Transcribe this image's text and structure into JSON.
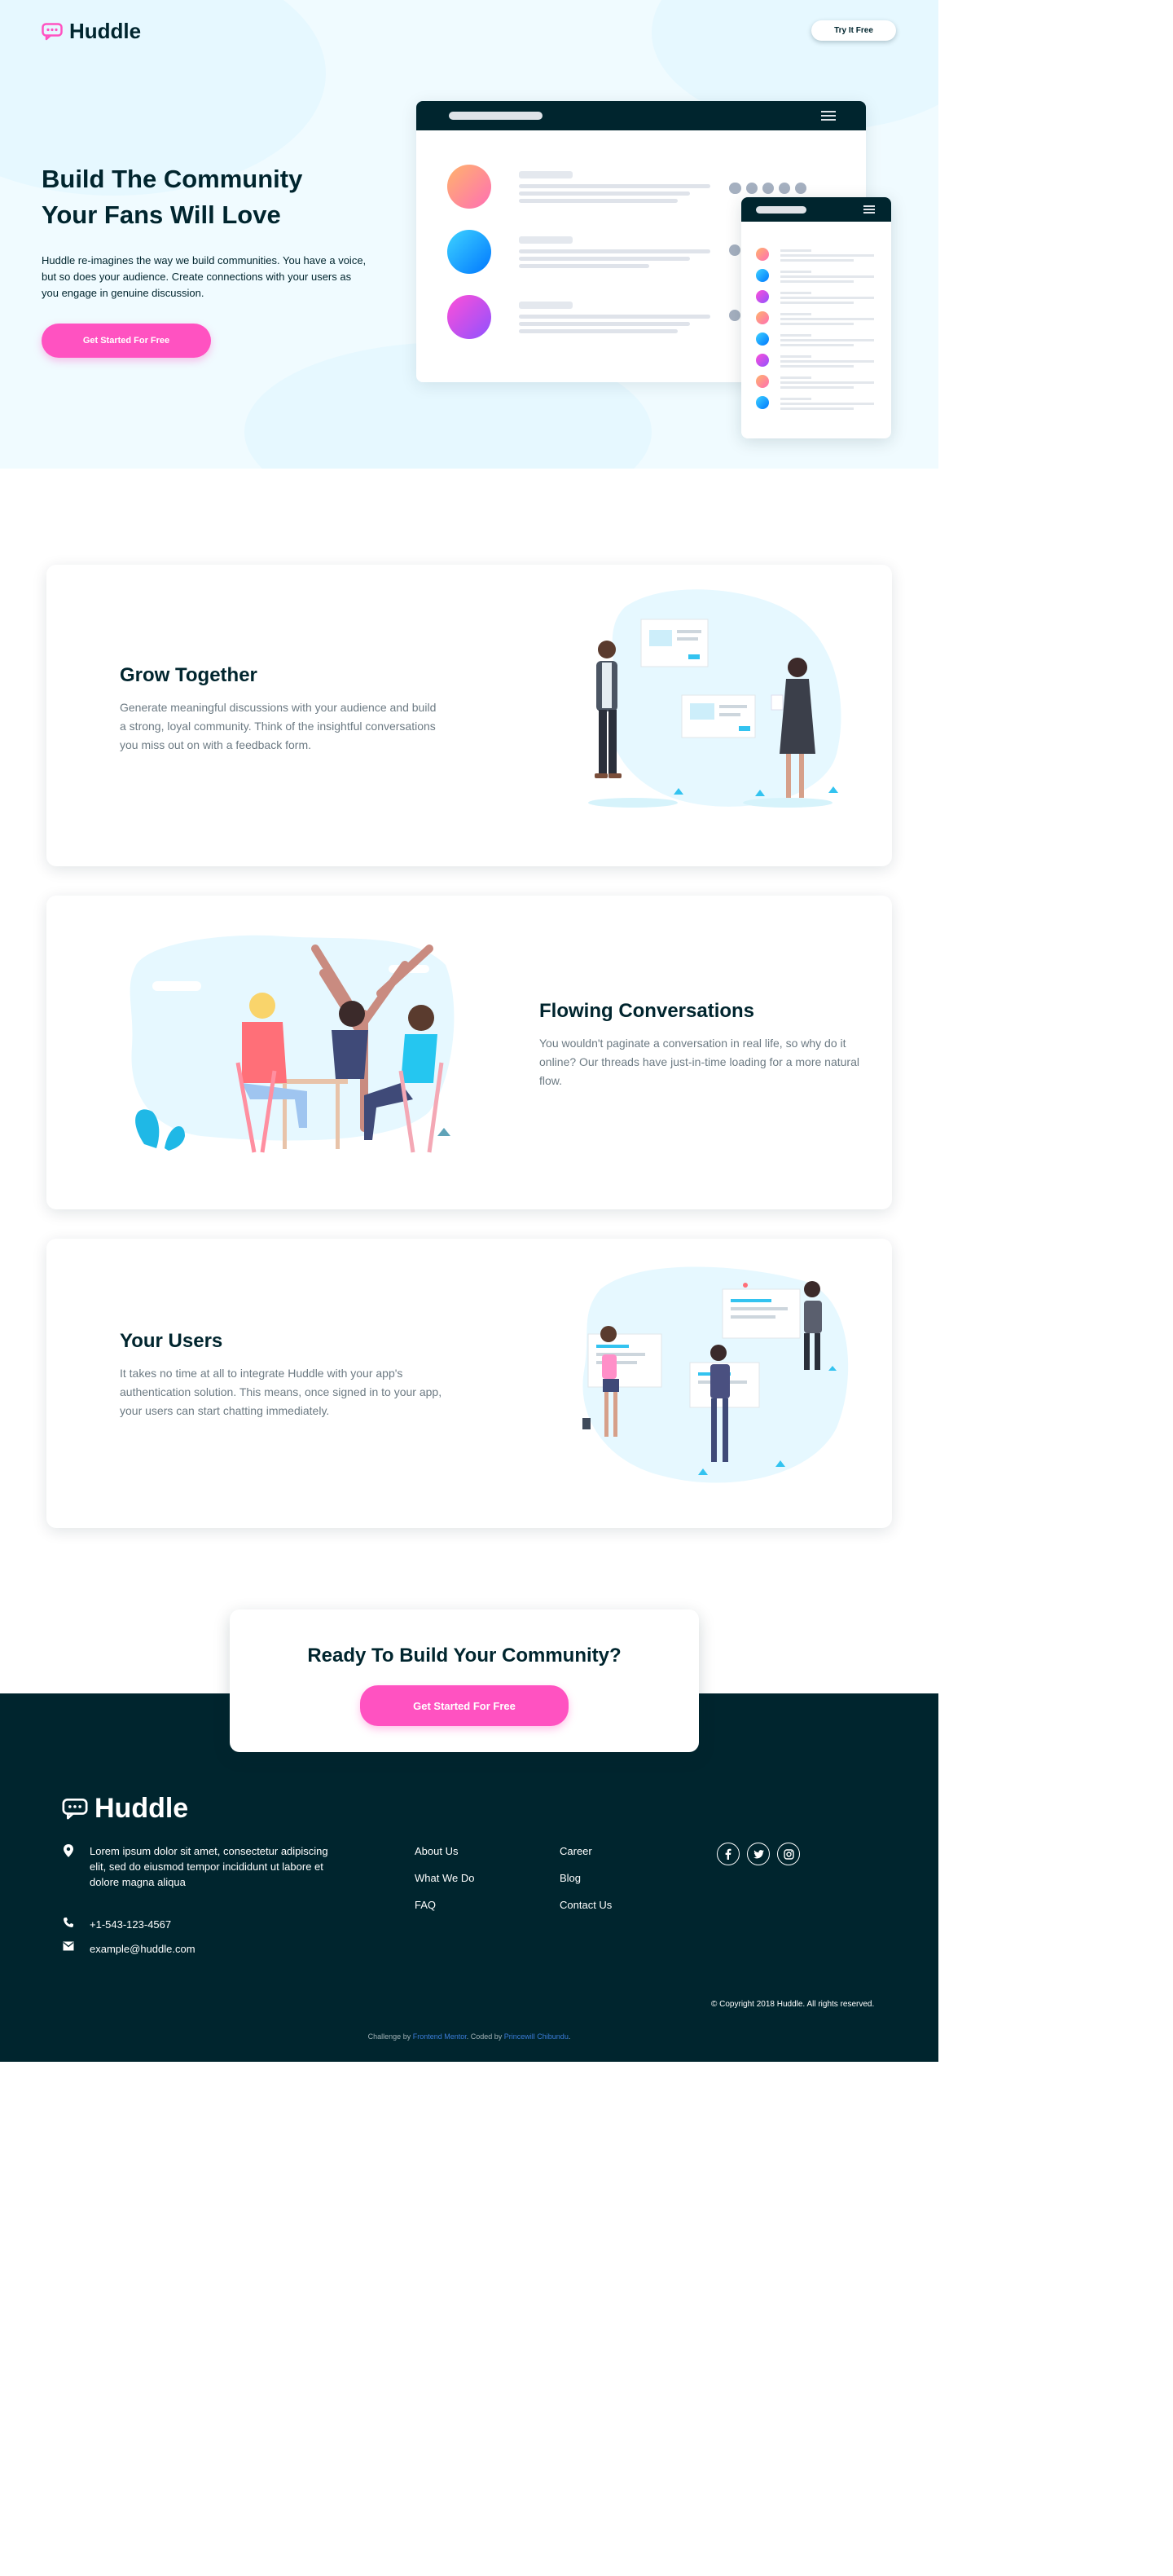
{
  "header": {
    "logo_text": "Huddle",
    "try_button": "Try It Free"
  },
  "hero": {
    "title_line1": "Build The Community",
    "title_line2": "Your Fans Will Love",
    "text": "Huddle re-imagines the way we build communities. You have a voice, but so does your audience. Create connections with your users as you engage in genuine discussion.",
    "cta": "Get Started For Free"
  },
  "features": [
    {
      "title": "Grow Together",
      "text": "Generate meaningful discussions with your audience and build a strong, loyal community. Think of the insightful conversations you miss out on with a feedback form."
    },
    {
      "title": "Flowing Conversations",
      "text": "You wouldn't paginate a conversation in real life, so why do it online? Our threads have just-in-time loading for a more natural flow."
    },
    {
      "title": "Your Users",
      "text": "It takes no time at all to integrate Huddle with your app's authentication solution. This means, once signed in to your app, your users can start chatting immediately."
    }
  ],
  "cta": {
    "title": "Ready To Build Your Community?",
    "button": "Get Started For Free"
  },
  "footer": {
    "logo_text": "Huddle",
    "address": "Lorem ipsum dolor sit amet, consectetur adipiscing elit, sed do eiusmod tempor incididunt ut labore et dolore magna aliqua",
    "phone": "+1-543-123-4567",
    "email": "example@huddle.com",
    "links_col1": [
      "About Us",
      "What We Do",
      "FAQ"
    ],
    "links_col2": [
      "Career",
      "Blog",
      "Contact Us"
    ],
    "social_icons": [
      "facebook-icon",
      "twitter-icon",
      "instagram-icon"
    ],
    "copyright": "© Copyright 2018 Huddle. All rights reserved.",
    "attribution_prefix": "Challenge by ",
    "attribution_link1": "Frontend Mentor",
    "attribution_middle": ". Coded by ",
    "attribution_link2": "Princewill Chibundu",
    "attribution_suffix": "."
  },
  "colors": {
    "dark": "#00252e",
    "pink": "#ff52c1",
    "hero_bg": "#f0fbff",
    "gray_text": "#6c7a83"
  }
}
